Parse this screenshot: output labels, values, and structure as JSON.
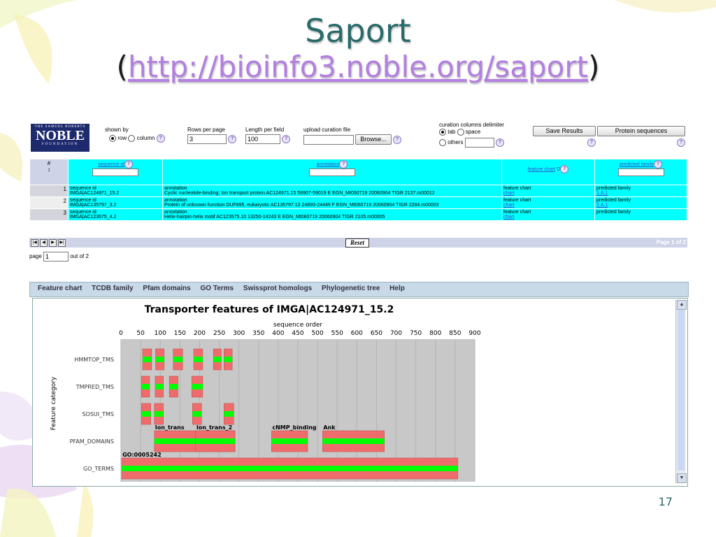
{
  "slide": {
    "title": "Saport",
    "url_open": "(",
    "url": "http://bioinfo3.noble.org/saport",
    "url_close": ")",
    "slide_number": "17"
  },
  "logo": {
    "small_top": "THE SAMUEL ROBERTS",
    "name": "NOBLE",
    "small_bottom": "FOUNDATION"
  },
  "controls": {
    "shown_by_label": "shown by",
    "row_label": "row",
    "column_label": "column",
    "rows_per_page_label": "Rows per page",
    "rows_per_page_value": "3",
    "length_per_field_label": "Length per field",
    "length_per_field_value": "100",
    "upload_label": "upload curation file",
    "browse_label": "Browse...",
    "delimiter_label": "curation columns delimiter",
    "tab_label": "tab",
    "space_label": "space",
    "others_label": "others",
    "save_results_label": "Save Results",
    "protein_sequences_label": "Protein sequences"
  },
  "table": {
    "headers": {
      "num": "#",
      "sequence_id": "sequence id",
      "annotation": "annotation",
      "feature_chart": "feature chart",
      "predicted_family": "predicted family"
    },
    "rows": [
      {
        "num": "1",
        "seq_label": "sequence id",
        "seq_id": "IMGA|AC124971_15.2",
        "ann_label": "annotation",
        "annotation": "Cyclic nucleotide-binding; Ion transport protein AC124971.15 59907-59019 E EGN_Mt060719 20060904 TIGR 2137.m00012",
        "fc_label": "feature chart",
        "fc_link": "chart",
        "pf_label": "predicted family",
        "pf_link": "1.A.1"
      },
      {
        "num": "2",
        "seq_label": "sequence id",
        "seq_id": "IMGA|AC135797_3.2",
        "ann_label": "annotation",
        "annotation": "Protein of unknown function DUF895, eukaryotic AC135797.13 24893-24449 F EGN_Mt060719 20060904 TIGR 2284.m00003",
        "fc_label": "feature chart",
        "fc_link": "chart",
        "pf_label": "predicted family",
        "pf_link": "2.A.1"
      },
      {
        "num": "3",
        "seq_label": "sequence id",
        "seq_id": "IMGA|AC123575_4.2",
        "ann_label": "annotation",
        "annotation": "Helix-hairpin-helix motif AC123575.10 13250-14243 E EGN_Mt060719 20060904 TIGR 2105.m00005",
        "fc_label": "feature chart",
        "fc_link": "chart",
        "pf_label": "predicted family",
        "pf_link": ""
      }
    ]
  },
  "pager": {
    "reset_label": "Reset",
    "page_info": "Page 1 of 2",
    "page_label": "page",
    "page_value": "1",
    "out_of": "out of 2"
  },
  "tabs": [
    "Feature chart",
    "TCDB family",
    "Pfam domains",
    "GO Terms",
    "Swissprot homologs",
    "Phylogenetic tree",
    "Help"
  ],
  "colors": {
    "cyan": "#00ffff",
    "bar_red": "#ef6c6c",
    "bar_green": "#00ff00",
    "chart_bg": "#c8c8c8",
    "title_teal": "#2a6a6a",
    "link_purple": "#b37fe0"
  },
  "chart_data": {
    "type": "bar",
    "title": "Transporter features of IMGA|AC124971_15.2",
    "xlabel": "sequence order",
    "ylabel": "Feature category",
    "xlim": [
      0,
      900
    ],
    "xticks": [
      0,
      50,
      100,
      150,
      200,
      250,
      300,
      350,
      400,
      450,
      500,
      550,
      600,
      650,
      700,
      750,
      800,
      850,
      900
    ],
    "categories": [
      "HMMTOP_TMS",
      "TMPRED_TMS",
      "SOSUI_TMS",
      "PFAM_DOMAINS",
      "GO_TERMS"
    ],
    "segments": [
      {
        "category": "HMMTOP_TMS",
        "start": 55,
        "end": 78,
        "label": ""
      },
      {
        "category": "HMMTOP_TMS",
        "start": 88,
        "end": 110,
        "label": ""
      },
      {
        "category": "HMMTOP_TMS",
        "start": 133,
        "end": 157,
        "label": ""
      },
      {
        "category": "HMMTOP_TMS",
        "start": 185,
        "end": 208,
        "label": ""
      },
      {
        "category": "HMMTOP_TMS",
        "start": 235,
        "end": 255,
        "label": ""
      },
      {
        "category": "HMMTOP_TMS",
        "start": 262,
        "end": 283,
        "label": ""
      },
      {
        "category": "TMPRED_TMS",
        "start": 52,
        "end": 73,
        "label": ""
      },
      {
        "category": "TMPRED_TMS",
        "start": 87,
        "end": 108,
        "label": ""
      },
      {
        "category": "TMPRED_TMS",
        "start": 123,
        "end": 145,
        "label": ""
      },
      {
        "category": "TMPRED_TMS",
        "start": 180,
        "end": 208,
        "label": ""
      },
      {
        "category": "SOSUI_TMS",
        "start": 52,
        "end": 76,
        "label": ""
      },
      {
        "category": "SOSUI_TMS",
        "start": 85,
        "end": 108,
        "label": ""
      },
      {
        "category": "SOSUI_TMS",
        "start": 182,
        "end": 205,
        "label": ""
      },
      {
        "category": "SOSUI_TMS",
        "start": 262,
        "end": 287,
        "label": ""
      },
      {
        "category": "PFAM_DOMAINS",
        "start": 85,
        "end": 290,
        "label": "Ion_trans"
      },
      {
        "category": "PFAM_DOMAINS",
        "start": 190,
        "end": 290,
        "label": "Ion_trans_2"
      },
      {
        "category": "PFAM_DOMAINS",
        "start": 383,
        "end": 475,
        "label": "cNMP_binding"
      },
      {
        "category": "PFAM_DOMAINS",
        "start": 513,
        "end": 670,
        "label": "Ank"
      },
      {
        "category": "GO_TERMS",
        "start": 2,
        "end": 857,
        "label": "GO:0005242"
      }
    ]
  }
}
